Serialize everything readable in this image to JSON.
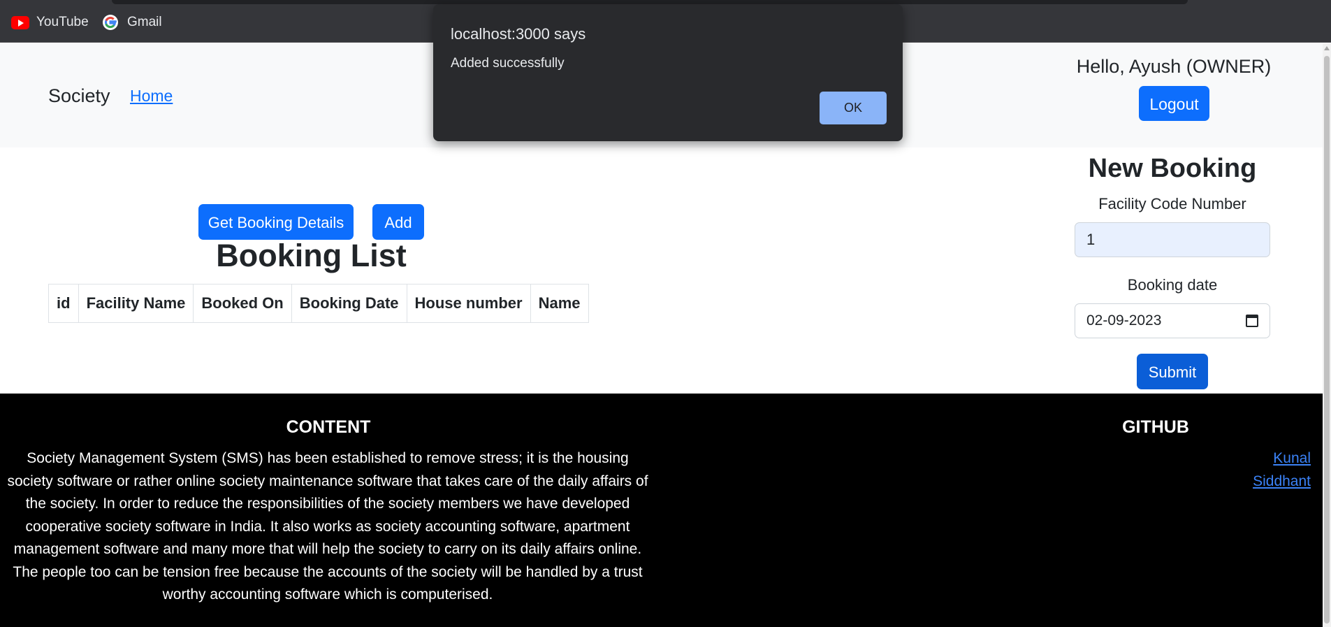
{
  "bookmarks": [
    {
      "label": "YouTube",
      "icon": "youtube-icon"
    },
    {
      "label": "Gmail",
      "icon": "google-icon"
    }
  ],
  "navbar": {
    "brand": "Society",
    "home_link": "Home",
    "greeting": "Hello, Ayush (OWNER)",
    "logout_label": "Logout"
  },
  "booking_list": {
    "get_details_label": "Get Booking Details",
    "add_label": "Add",
    "title": "Booking List",
    "columns": [
      "id",
      "Facility Name",
      "Booked On",
      "Booking Date",
      "House number",
      "Name"
    ]
  },
  "new_booking": {
    "title": "New Booking",
    "facility_code_label": "Facility Code Number",
    "facility_code_value": "1",
    "booking_date_label": "Booking date",
    "booking_date_value": "02-09-2023",
    "submit_label": "Submit"
  },
  "footer": {
    "content_title": "CONTENT",
    "content_text": "Society Management System (SMS) has been established to remove stress; it is the housing society software or rather online society maintenance software that takes care of the daily affairs of the society. In order to reduce the responsibilities of the society members we have developed cooperative society software in India. It also works as society accounting software, apartment management software and many more that will help the society to carry on its daily affairs online. The people too can be tension free because the accounts of the society will be handled by a trust worthy accounting software which is computerised.",
    "github_title": "GITHUB",
    "github_links": [
      "Kunal",
      "Siddhant"
    ]
  },
  "dialog": {
    "title": "localhost:3000 says",
    "message": "Added successfully",
    "ok_label": "OK"
  },
  "colors": {
    "primary": "#0d6efd",
    "navbar_bg": "#f8f9fa",
    "footer_bg": "#000000",
    "dialog_bg": "#292a2d",
    "dialog_button": "#8ab4f8"
  }
}
